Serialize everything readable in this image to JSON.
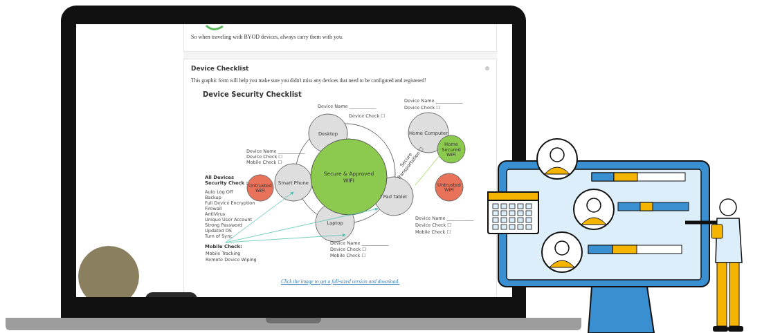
{
  "intro_card": {
    "text": "So when traveling with BYOD devices, always carry them with you."
  },
  "card": {
    "title": "Device Checklist",
    "description": "This graphic form will help you make sure you didn't miss any devices that need to be configured and registered!",
    "diagram": {
      "title": "Device Security Checklist",
      "hub_lines": [
        "Secure & Approved",
        "WIFI"
      ],
      "nodes": [
        {
          "lines": [
            "Desktop"
          ],
          "kind": "device"
        },
        {
          "lines": [
            "Smart Phone"
          ],
          "kind": "device"
        },
        {
          "lines": [
            "I Pad Tablet"
          ],
          "kind": "device"
        },
        {
          "lines": [
            "Laptop"
          ],
          "kind": "device"
        },
        {
          "lines": [
            "Home Computer"
          ],
          "kind": "device"
        },
        {
          "lines": [
            "Home",
            "Secured",
            "WiFi"
          ],
          "kind": "secure"
        },
        {
          "lines": [
            "Untrusted",
            "WiFi"
          ],
          "kind": "untrusted"
        },
        {
          "lines": [
            "Untrusted",
            "WiFi"
          ],
          "kind": "untrusted"
        }
      ],
      "text_blocks": [
        {
          "lines": [
            "Device Name ____________",
            "Device Check ☐"
          ]
        },
        {
          "lines": [
            "Device Name ____________",
            "Device Check ☐"
          ]
        },
        {
          "lines": [
            "Device Name ____________",
            "Device Check ☐",
            "Mobile Check ☐"
          ]
        },
        {
          "lines": [
            "Device Name  ____________",
            "Device Check ☐",
            "Mobile Check ☐"
          ]
        },
        {
          "lines": [
            "Device Name ____________",
            "Device Check ☐",
            "Mobile Check ☐"
          ]
        }
      ],
      "transport_lines": [
        "Secure",
        "Transportation ☐"
      ],
      "all_devices": {
        "heading_lines": [
          "All Devices",
          "Security Check :"
        ],
        "items": [
          "Auto Log Off",
          "Backup",
          "Full Device Encryption",
          "Firewall",
          "AntiVirus",
          "Unique User Account",
          "Strong Password",
          "Updated OS",
          "Turn of Sync"
        ]
      },
      "mobile": {
        "heading": "Mobile Check:",
        "items": [
          "Mobile Tracking",
          "Remote Device Wiping"
        ]
      }
    },
    "link": "Click the image to get a full-sized version and download."
  }
}
